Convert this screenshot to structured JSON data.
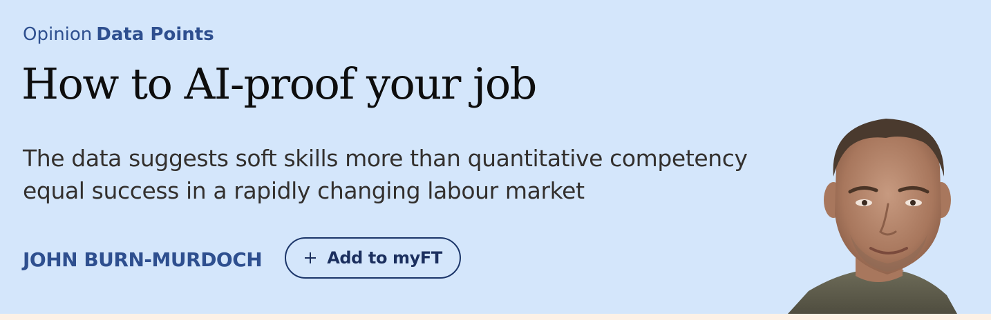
{
  "article": {
    "kicker_prefix": "Opinion",
    "kicker_series": "Data Points",
    "headline": "How to AI-proof your job",
    "standfirst": "The data suggests soft skills more than quantitative competency equal success in a rapidly changing labour market",
    "author": "JOHN BURN-MURDOCH",
    "follow_button_label": "Add to myFT",
    "follow_icon": "plus-icon",
    "author_photo_icon": "author-headshot"
  },
  "colors": {
    "hero_background": "#d4e6fb",
    "page_background": "#fdf1e6",
    "accent": "#2e4f8f",
    "headline_text": "#0d0d0d",
    "body_text": "#33302e",
    "button_border": "#1b3569"
  }
}
